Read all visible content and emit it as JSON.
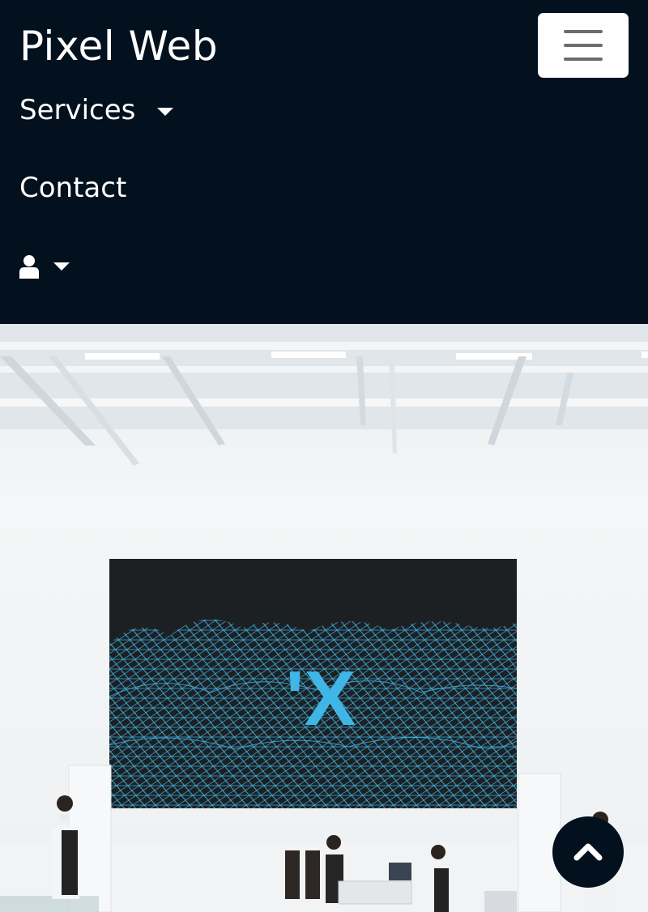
{
  "navbar": {
    "brand": "Pixel Web",
    "items": [
      {
        "label": "Services",
        "has_dropdown": true
      },
      {
        "label": "Contact",
        "has_dropdown": false
      }
    ],
    "user_menu": {
      "icon": "user-icon",
      "has_dropdown": true
    },
    "toggler_icon": "hamburger-menu-icon"
  },
  "hero": {
    "image": "cafe-interior-photo",
    "screen_text": "'X"
  },
  "scroll_top_icon": "chevron-up-icon",
  "colors": {
    "navbar_bg": "#03101e",
    "text": "#ffffff",
    "toggler_bg": "#ffffff",
    "toggler_bars": "#6c6c6c",
    "screen_accent": "#3fb6e6"
  }
}
